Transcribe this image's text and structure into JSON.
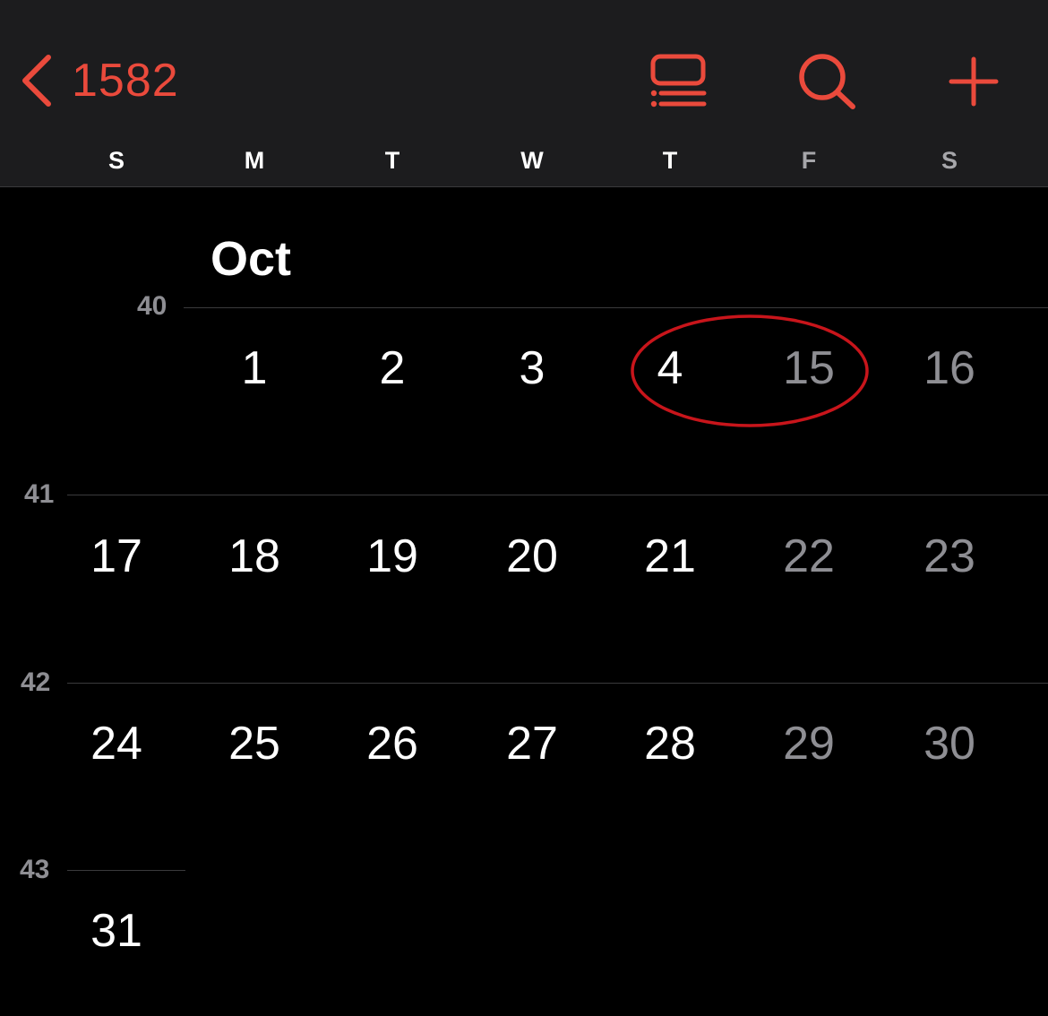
{
  "nav": {
    "back_label": "1582",
    "accent_color": "#ea4a3c",
    "icons": [
      "chevron-left-icon",
      "list-view-icon",
      "search-icon",
      "plus-icon"
    ]
  },
  "weekdays": [
    "S",
    "M",
    "T",
    "W",
    "T",
    "F",
    "S"
  ],
  "month": {
    "title": "Oct",
    "weeks": [
      {
        "number": "40",
        "days": [
          "",
          "1",
          "2",
          "3",
          "4",
          "15",
          "16"
        ]
      },
      {
        "number": "41",
        "days": [
          "17",
          "18",
          "19",
          "20",
          "21",
          "22",
          "23"
        ]
      },
      {
        "number": "42",
        "days": [
          "24",
          "25",
          "26",
          "27",
          "28",
          "29",
          "30"
        ]
      },
      {
        "number": "43",
        "days": [
          "31"
        ]
      }
    ]
  },
  "annotation": {
    "shape": "ellipse",
    "color": "#c8151b",
    "circled_days": [
      "4",
      "15"
    ]
  }
}
